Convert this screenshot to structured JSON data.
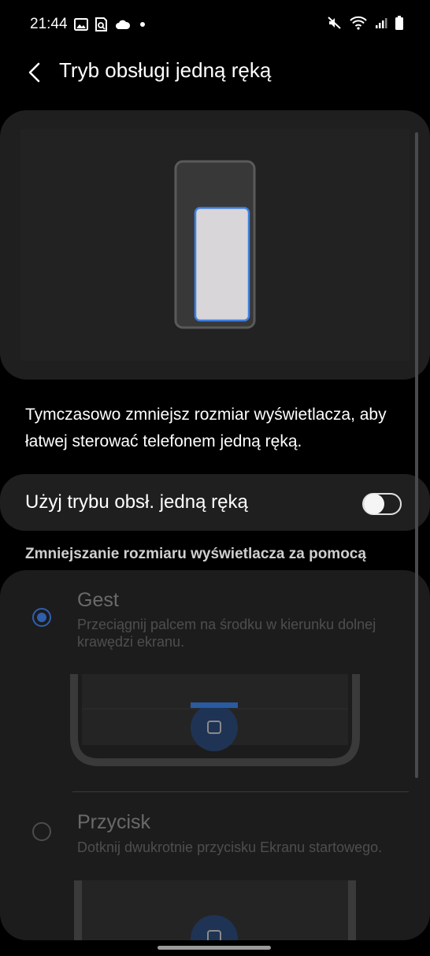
{
  "status_bar": {
    "time": "21:44",
    "left_icons": [
      "image-icon",
      "screenshot-search-icon",
      "cloud-icon",
      "dot-icon"
    ],
    "right_icons": [
      "mute-icon",
      "wifi-icon",
      "signal-icon",
      "battery-icon"
    ]
  },
  "header": {
    "title": "Tryb obsługi jedną ręką"
  },
  "description": "Tymczasowo zmniejsz rozmiar wyświetlacza, aby łatwej sterować telefonem jedną ręką.",
  "toggle_row": {
    "label": "Użyj trybu obsł. jedną ręką",
    "enabled": false
  },
  "section_header": "Zmniejszanie rozmiaru wyświetlacza za pomocą",
  "options": [
    {
      "title": "Gest",
      "description": "Przeciągnij palcem na środku w kierunku dolnej krawędzi ekranu.",
      "selected": true
    },
    {
      "title": "Przycisk",
      "description": "Dotknij dwukrotnie przycisku Ekranu startowego.",
      "selected": false
    }
  ],
  "colors": {
    "accent": "#2f5fae",
    "highlight": "#3d7fe0",
    "card_background": "#1f1f1f"
  }
}
